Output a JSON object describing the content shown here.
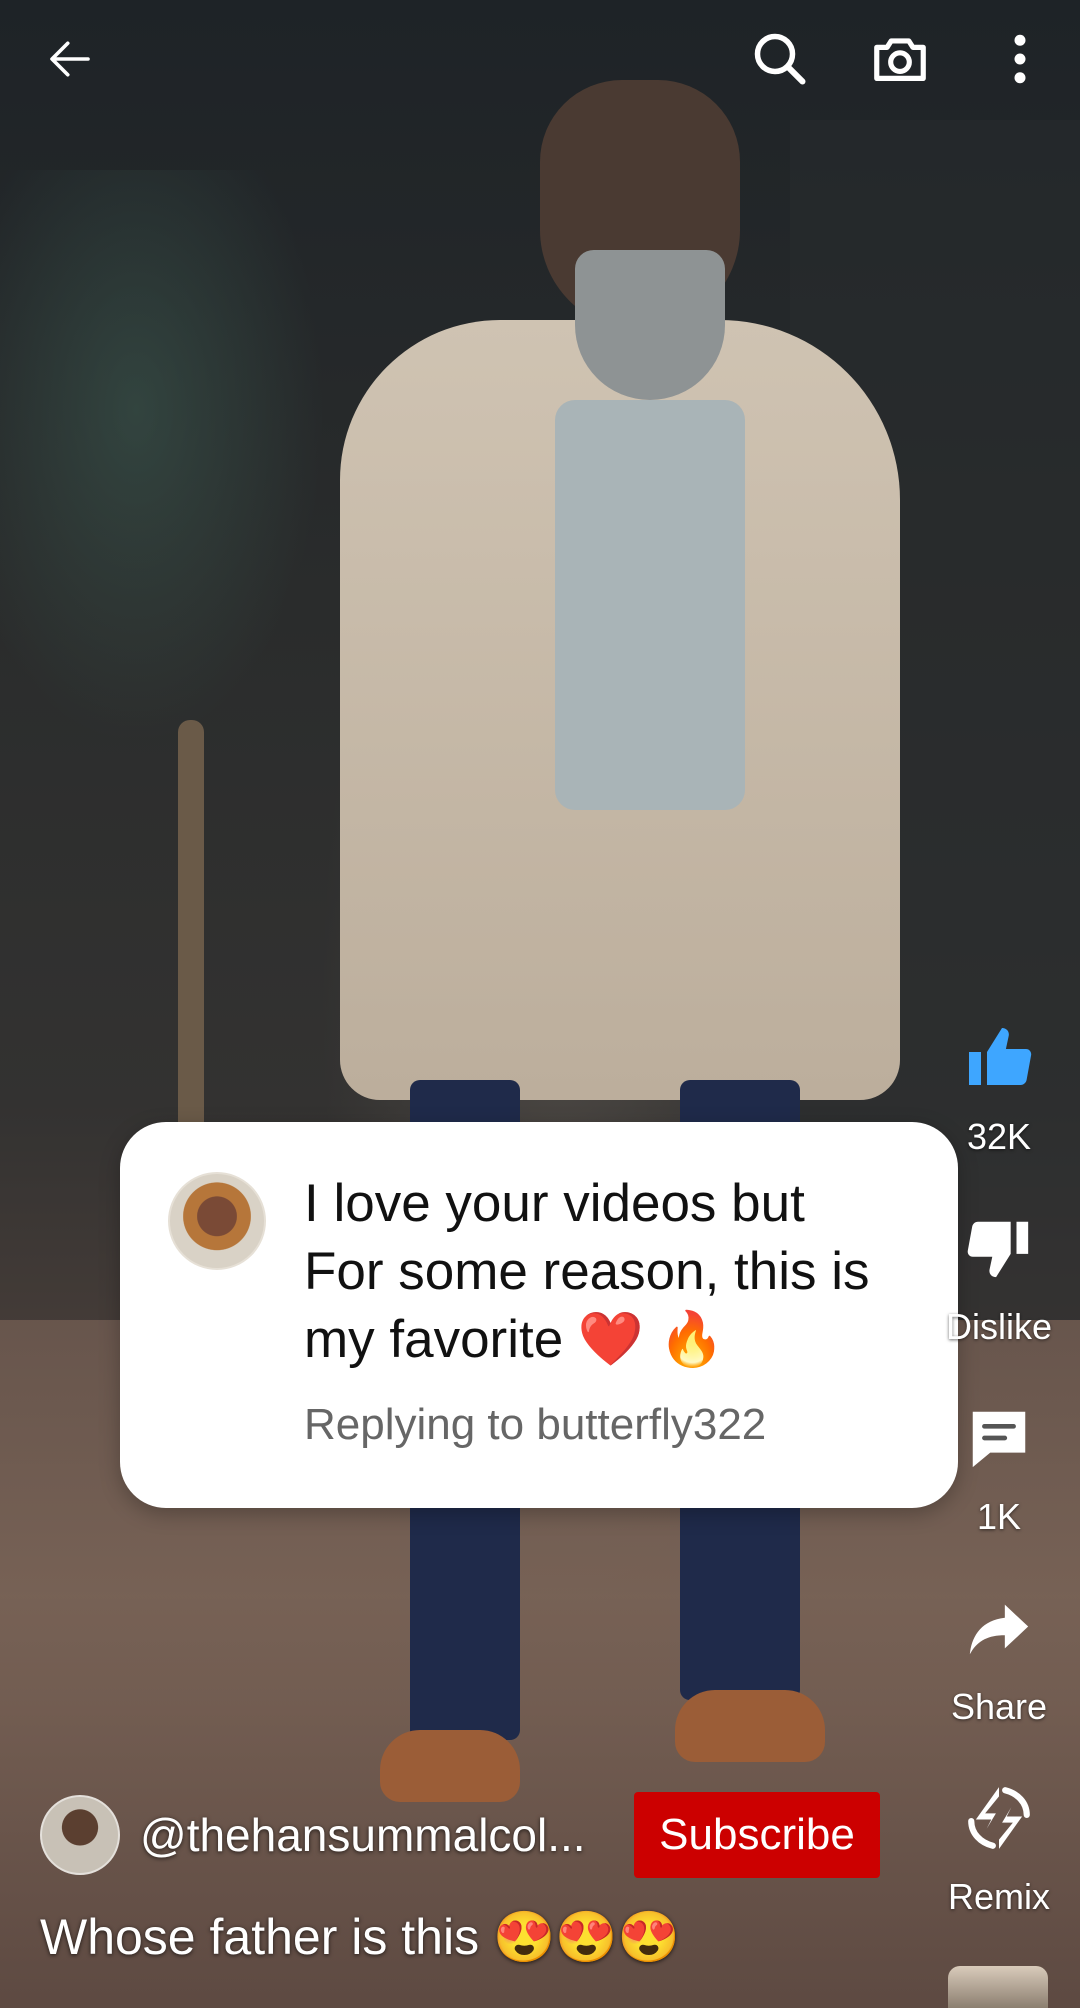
{
  "topbar": {
    "back_icon": "arrow-left-icon",
    "search_icon": "search-icon",
    "camera_icon": "camera-icon",
    "more_icon": "more-vertical-icon"
  },
  "comment": {
    "lines": [
      "I love your videos but",
      "For some reason, this is",
      "my favorite ❤️ 🔥"
    ],
    "reply": "Replying to butterfly322"
  },
  "actions": {
    "like": {
      "label": "32K",
      "icon": "thumbs-up-icon",
      "color": "#3ea6ff"
    },
    "dislike": {
      "label": "Dislike",
      "icon": "thumbs-down-icon"
    },
    "comments": {
      "label": "1K",
      "icon": "comment-icon"
    },
    "share": {
      "label": "Share",
      "icon": "share-icon"
    },
    "remix": {
      "label": "Remix",
      "icon": "remix-icon"
    }
  },
  "channel": {
    "handle": "@thehansummalcol...",
    "subscribe_label": "Subscribe",
    "subscribe_color": "#cc0000"
  },
  "caption": "Whose father is this 😍😍😍"
}
